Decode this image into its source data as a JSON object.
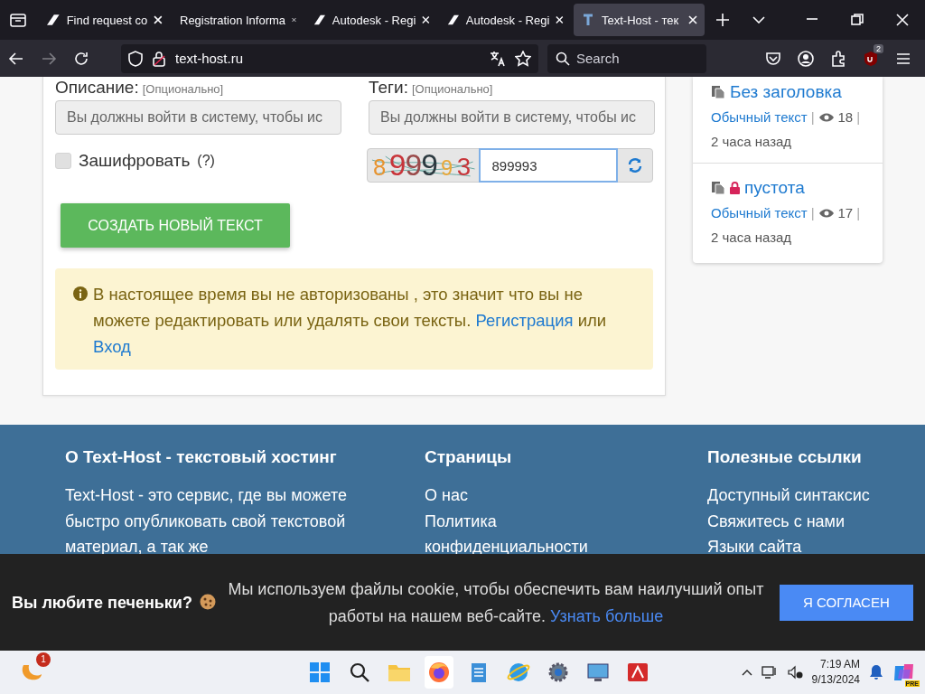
{
  "browser": {
    "tabs": [
      {
        "title": "Find request co",
        "selected": false
      },
      {
        "title": "Registration Informa",
        "selected": false
      },
      {
        "title": "Autodesk - Regi",
        "selected": false
      },
      {
        "title": "Autodesk - Regi",
        "selected": false
      },
      {
        "title": "Text-Host - тек",
        "selected": true
      }
    ],
    "url": "text-host.ru",
    "search_placeholder": "Search",
    "extension_badge": "2",
    "forward_disabled": true
  },
  "form": {
    "fields": [
      {
        "label": "Описание:",
        "hint": "[Опционально]",
        "placeholder": "Вы должны войти в систему, чтобы ис",
        "disabled": true
      },
      {
        "label": "Теги:",
        "hint": "[Опционально]",
        "placeholder": "Вы должны войти в систему, чтобы ис",
        "disabled": true
      }
    ],
    "encrypt": {
      "label": "Зашифровать",
      "help": "(?)",
      "checked": false
    },
    "captcha": {
      "glyphs": [
        {
          "text": "8",
          "color": "#e8932e"
        },
        {
          "text": "9",
          "color": "#c8353a"
        },
        {
          "text": "9",
          "color": "#9a4a4a"
        },
        {
          "text": "9",
          "color": "#2c3a40"
        },
        {
          "text": "9",
          "color": "#e8a83a"
        },
        {
          "text": "3",
          "color": "#c8353a"
        }
      ],
      "value": "899993"
    },
    "submit": "СОЗДАТЬ НОВЫЙ ТЕКСТ",
    "alert": {
      "text": "В настоящее время вы не авторизованы , это значит что вы не можете редактировать или удалять свои тексты.",
      "register": "Регистрация",
      "joiner": "или",
      "login": "Вход"
    }
  },
  "sidebar": {
    "separator": "|",
    "items": [
      {
        "title": "Без заголовка",
        "locked": false,
        "type": "Обычный текст",
        "views": "18",
        "time": "2 часа назад"
      },
      {
        "title": "пустота",
        "locked": true,
        "type": "Обычный текст",
        "views": "17",
        "time": "2 часа назад"
      }
    ]
  },
  "footer": {
    "about": {
      "title": "О Text-Host - текстовый хостинг",
      "text": "Text-Host - это сервис, где вы можете быстро опубликовать свой текстовой материал, а так же"
    },
    "columns": [
      {
        "title": "Страницы",
        "links": [
          "О нас",
          "Политика конфиденциальности"
        ]
      },
      {
        "title": "Полезные ссылки",
        "links": [
          "Доступный синтаксис",
          "Свяжитесь с нами",
          "Языки сайта"
        ]
      }
    ]
  },
  "cookie": {
    "title": "Вы любите печеньки?",
    "text": "Мы используем файлы cookie, чтобы обеспечить вам наилучший опыт работы на нашем веб-сайте.",
    "link": "Узнать больше",
    "button": "Я СОГЛАСЕН"
  },
  "taskbar": {
    "weather_badge": "1",
    "copilot_badge": "PRE",
    "time": "7:19 AM",
    "date": "9/13/2024"
  }
}
